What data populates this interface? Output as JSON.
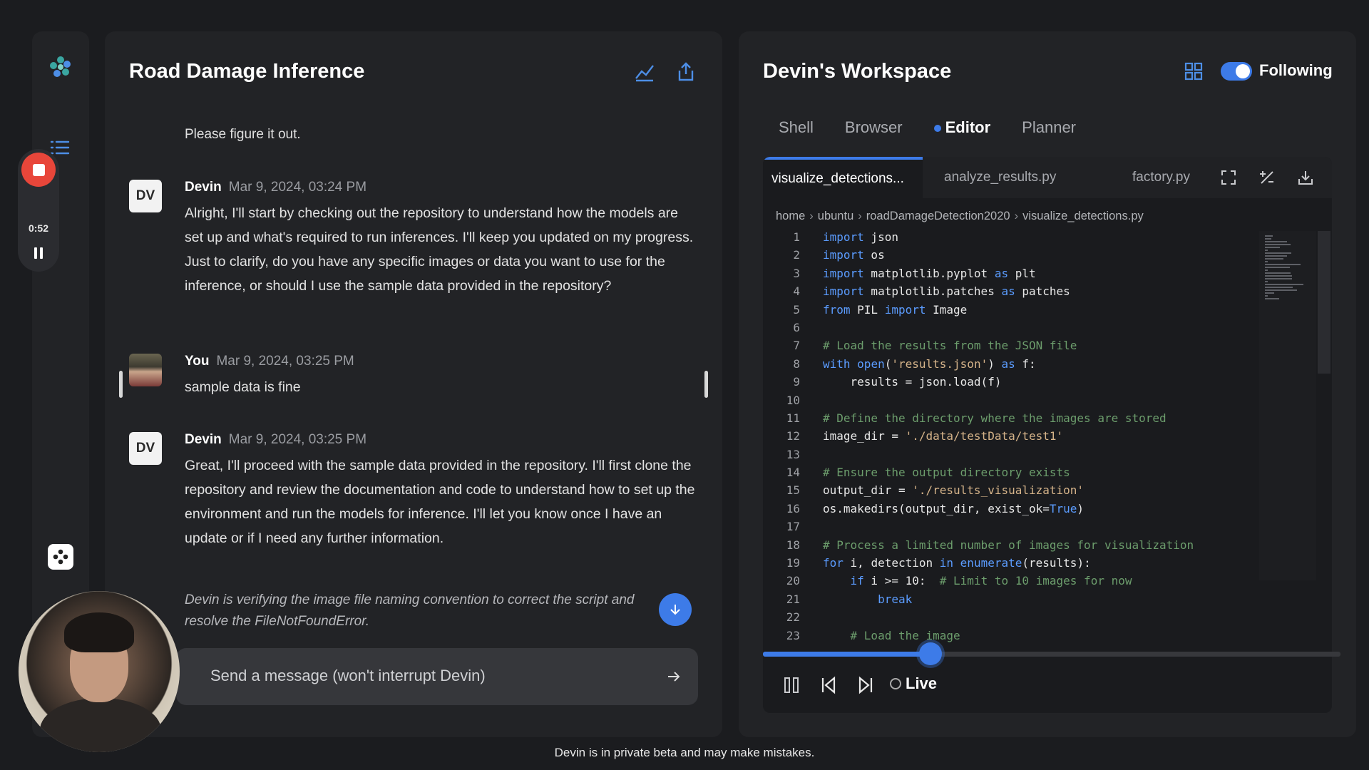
{
  "chat": {
    "title": "Road Damage Inference",
    "top_message": "Please figure it out.",
    "messages": [
      {
        "avatar": "DV",
        "name": "Devin",
        "time": "Mar 9, 2024, 03:24 PM",
        "body": "Alright, I'll start by checking out the repository to understand how the models are set up and what's required to run inferences. I'll keep you updated on my progress. Just to clarify, do you have any specific images or data you want to use for the inference, or should I use the sample data provided in the repository?"
      },
      {
        "avatar": "",
        "name": "You",
        "time": "Mar 9, 2024, 03:25 PM",
        "body": "sample data is fine"
      },
      {
        "avatar": "DV",
        "name": "Devin",
        "time": "Mar 9, 2024, 03:25 PM",
        "body": "Great, I'll proceed with the sample data provided in the repository. I'll first clone the repository and review the documentation and code to understand how to set up the environment and run the models for inference. I'll let you know once I have an update or if I need any further information."
      }
    ],
    "status": "Devin is verifying the image file naming convention to correct the script and resolve the FileNotFoundError.",
    "send_placeholder": "Send a message (won't interrupt Devin)"
  },
  "recorder": {
    "time": "0:52"
  },
  "workspace": {
    "title": "Devin's Workspace",
    "following_label": "Following",
    "following_on": true,
    "tabs": [
      "Shell",
      "Browser",
      "Editor",
      "Planner"
    ],
    "active_tab": "Editor",
    "files": [
      "visualize_detections...",
      "analyze_results.py",
      "factory.py"
    ],
    "breadcrumb": [
      "home",
      "ubuntu",
      "roadDamageDetection2020",
      "visualize_detections.py"
    ],
    "code_lines": [
      {
        "n": "1",
        "t": "import json"
      },
      {
        "n": "2",
        "t": "import os"
      },
      {
        "n": "3",
        "t": "import matplotlib.pyplot as plt"
      },
      {
        "n": "4",
        "t": "import matplotlib.patches as patches"
      },
      {
        "n": "5",
        "t": "from PIL import Image"
      },
      {
        "n": "6",
        "t": ""
      },
      {
        "n": "7",
        "t": "# Load the results from the JSON file"
      },
      {
        "n": "8",
        "t": "with open('results.json') as f:"
      },
      {
        "n": "9",
        "t": "    results = json.load(f)"
      },
      {
        "n": "10",
        "t": ""
      },
      {
        "n": "11",
        "t": "# Define the directory where the images are stored"
      },
      {
        "n": "12",
        "t": "image_dir = './data/testData/test1'"
      },
      {
        "n": "13",
        "t": ""
      },
      {
        "n": "14",
        "t": "# Ensure the output directory exists"
      },
      {
        "n": "15",
        "t": "output_dir = './results_visualization'"
      },
      {
        "n": "16",
        "t": "os.makedirs(output_dir, exist_ok=True)"
      },
      {
        "n": "17",
        "t": ""
      },
      {
        "n": "18",
        "t": "# Process a limited number of images for visualization"
      },
      {
        "n": "19",
        "t": "for i, detection in enumerate(results):"
      },
      {
        "n": "20",
        "t": "    if i >= 10:  # Limit to 10 images for now"
      },
      {
        "n": "21",
        "t": "        break"
      },
      {
        "n": "22",
        "t": ""
      },
      {
        "n": "23",
        "t": "    # Load the image"
      }
    ],
    "playback_progress": 0.29,
    "live_label": "Live"
  },
  "footer": "Devin is in private beta and may make mistakes.",
  "colors": {
    "accent": "#3d7be8",
    "record": "#e8463a"
  }
}
